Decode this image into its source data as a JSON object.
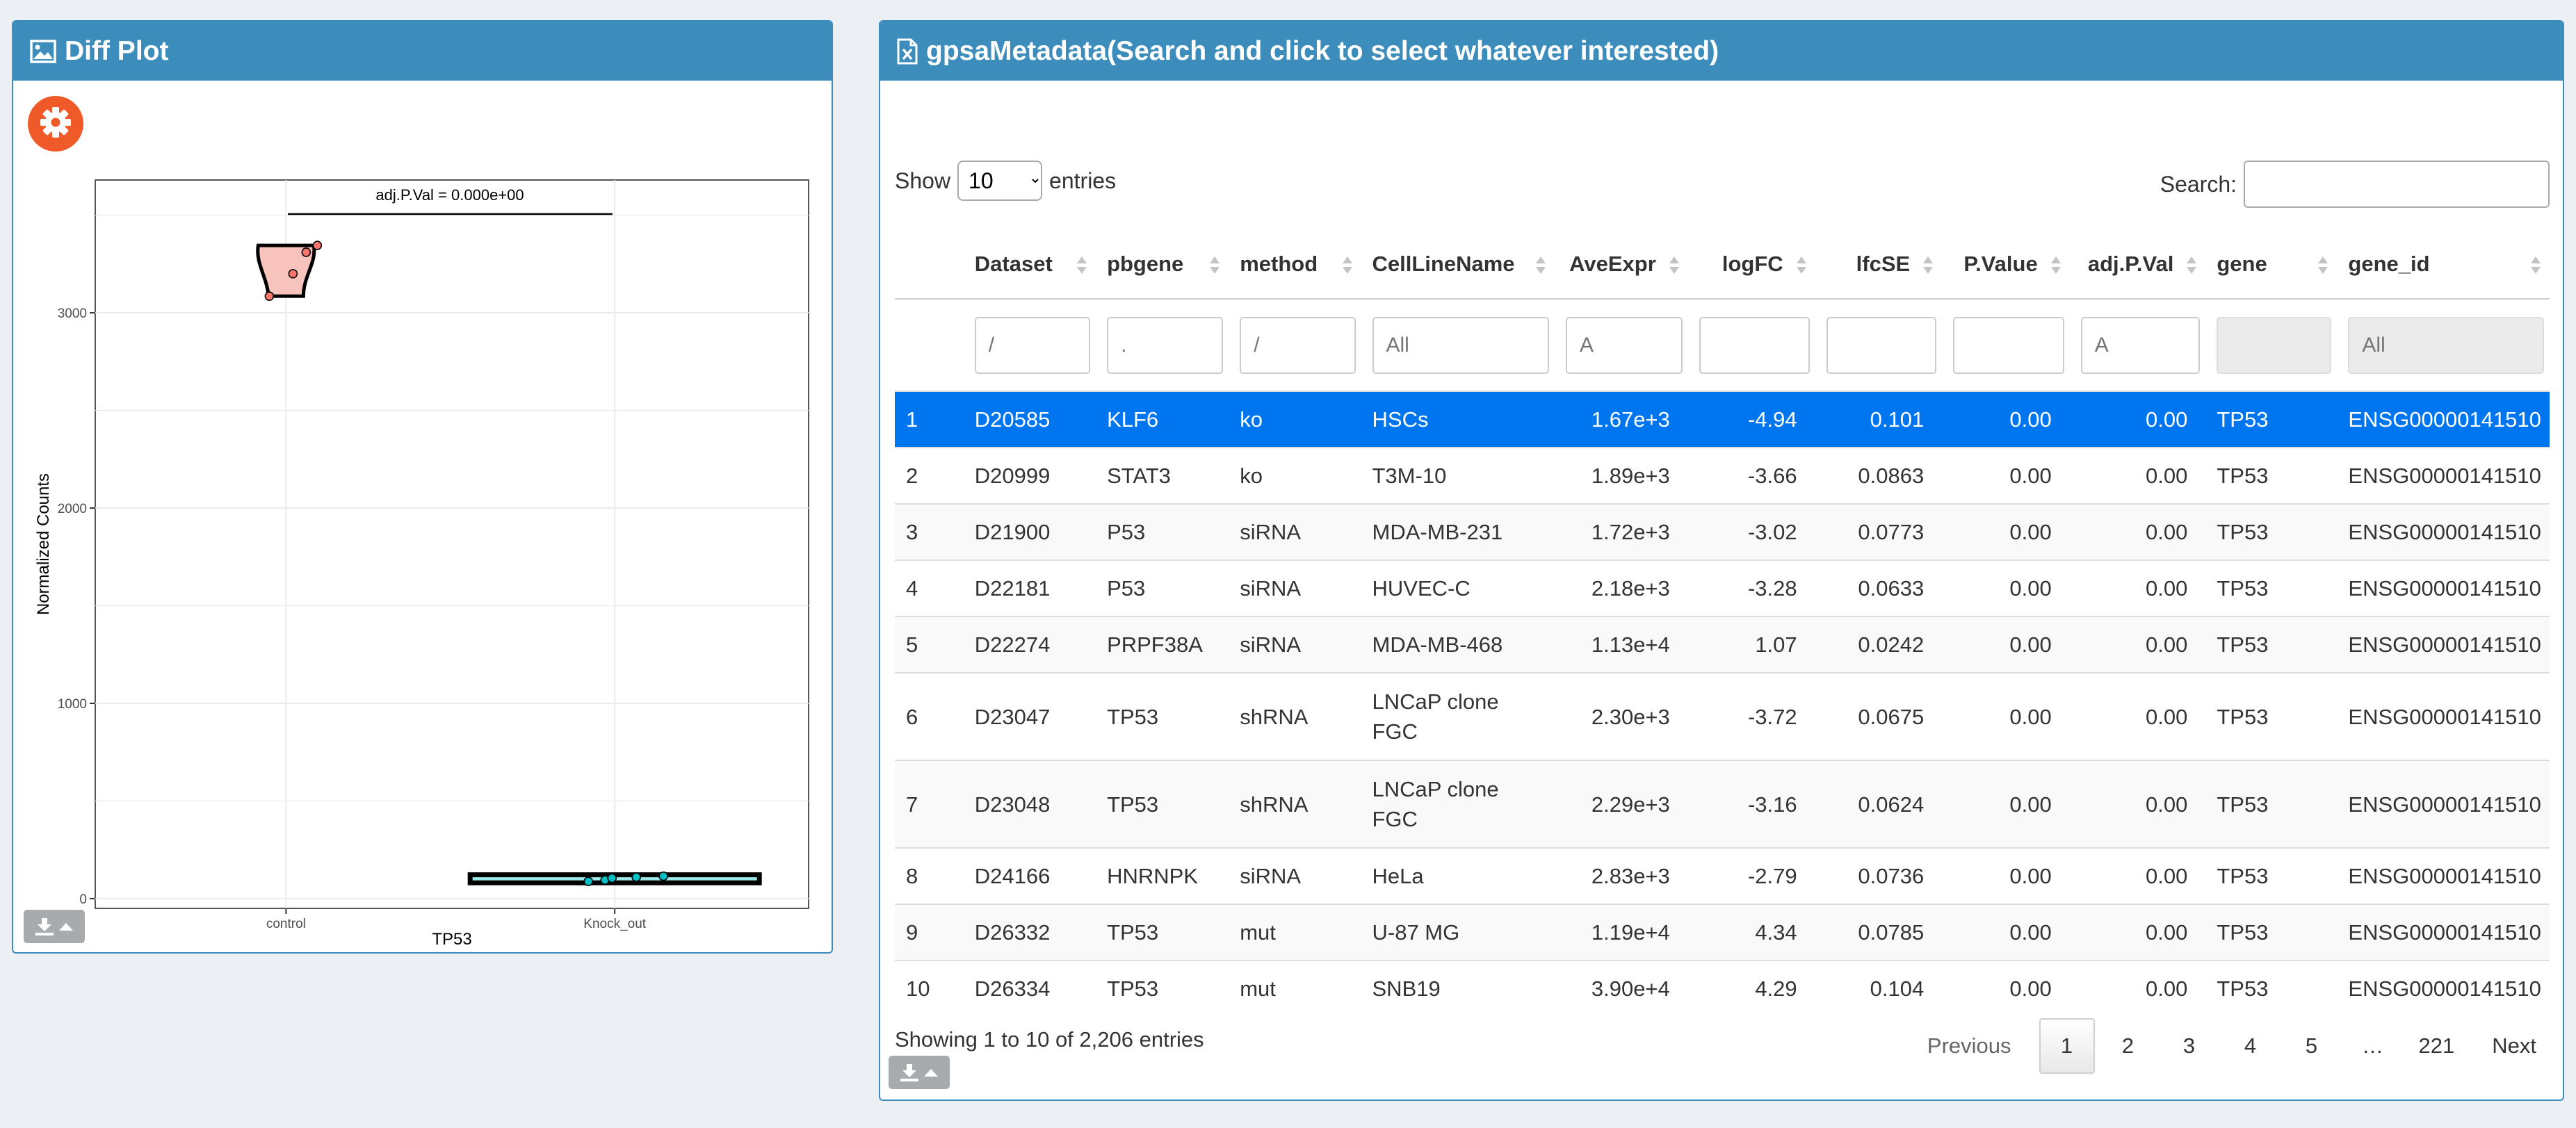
{
  "left_panel": {
    "title": "Diff Plot",
    "icons": {
      "header": "image-icon",
      "settings": "gear-icon",
      "download": "download-icon",
      "caret": "caret-up-icon"
    }
  },
  "chart_data": {
    "type": "violin",
    "annotation": "adj.P.Val = 0.000e+00",
    "xlabel": "TP53",
    "ylabel": "Normalized Counts",
    "categories": [
      "control",
      "Knock_out"
    ],
    "y_ticks": [
      0,
      1000,
      2000,
      3000
    ],
    "ylim": [
      -50,
      3680
    ],
    "grid": true,
    "series": [
      {
        "category": "control",
        "color": "#f8766d",
        "values": [
          3085,
          3200,
          3310,
          3345
        ]
      },
      {
        "category": "Knock_out",
        "color": "#00bfc4",
        "values": [
          88,
          95,
          105,
          110,
          115
        ]
      }
    ]
  },
  "right_panel": {
    "title": "gpsaMetadata(Search and click to select whatever interested)",
    "icons": {
      "header": "excel-file-icon",
      "download": "download-icon",
      "caret": "caret-up-icon"
    },
    "length": {
      "show": "Show",
      "value": "10",
      "entries": "entries"
    },
    "search_label": "Search:",
    "columns": [
      "",
      "Dataset",
      "pbgene",
      "method",
      "CellLineName",
      "AveExpr",
      "logFC",
      "lfcSE",
      "P.Value",
      "adj.P.Val",
      "gene",
      "gene_id"
    ],
    "filters": [
      "",
      "/",
      ".",
      "/",
      "All",
      "A",
      "",
      "",
      "",
      "A",
      "",
      "All"
    ],
    "rows": [
      [
        "1",
        "D20585",
        "KLF6",
        "ko",
        "HSCs",
        "1.67e+3",
        "-4.94",
        "0.101",
        "0.00",
        "0.00",
        "TP53",
        "ENSG00000141510"
      ],
      [
        "2",
        "D20999",
        "STAT3",
        "ko",
        "T3M-10",
        "1.89e+3",
        "-3.66",
        "0.0863",
        "0.00",
        "0.00",
        "TP53",
        "ENSG00000141510"
      ],
      [
        "3",
        "D21900",
        "P53",
        "siRNA",
        "MDA-MB-231",
        "1.72e+3",
        "-3.02",
        "0.0773",
        "0.00",
        "0.00",
        "TP53",
        "ENSG00000141510"
      ],
      [
        "4",
        "D22181",
        "P53",
        "siRNA",
        "HUVEC-C",
        "2.18e+3",
        "-3.28",
        "0.0633",
        "0.00",
        "0.00",
        "TP53",
        "ENSG00000141510"
      ],
      [
        "5",
        "D22274",
        "PRPF38A",
        "siRNA",
        "MDA-MB-468",
        "1.13e+4",
        "1.07",
        "0.0242",
        "0.00",
        "0.00",
        "TP53",
        "ENSG00000141510"
      ],
      [
        "6",
        "D23047",
        "TP53",
        "shRNA",
        "LNCaP clone FGC",
        "2.30e+3",
        "-3.72",
        "0.0675",
        "0.00",
        "0.00",
        "TP53",
        "ENSG00000141510"
      ],
      [
        "7",
        "D23048",
        "TP53",
        "shRNA",
        "LNCaP clone FGC",
        "2.29e+3",
        "-3.16",
        "0.0624",
        "0.00",
        "0.00",
        "TP53",
        "ENSG00000141510"
      ],
      [
        "8",
        "D24166",
        "HNRNPK",
        "siRNA",
        "HeLa",
        "2.83e+3",
        "-2.79",
        "0.0736",
        "0.00",
        "0.00",
        "TP53",
        "ENSG00000141510"
      ],
      [
        "9",
        "D26332",
        "TP53",
        "mut",
        "U-87 MG",
        "1.19e+4",
        "4.34",
        "0.0785",
        "0.00",
        "0.00",
        "TP53",
        "ENSG00000141510"
      ],
      [
        "10",
        "D26334",
        "TP53",
        "mut",
        "SNB19",
        "3.90e+4",
        "4.29",
        "0.104",
        "0.00",
        "0.00",
        "TP53",
        "ENSG00000141510"
      ]
    ],
    "selected_row": 0,
    "info": "Showing 1 to 10 of 2,206 entries",
    "pagination": [
      "Previous",
      "1",
      "2",
      "3",
      "4",
      "5",
      "…",
      "221",
      "Next"
    ],
    "current_page": "1"
  }
}
